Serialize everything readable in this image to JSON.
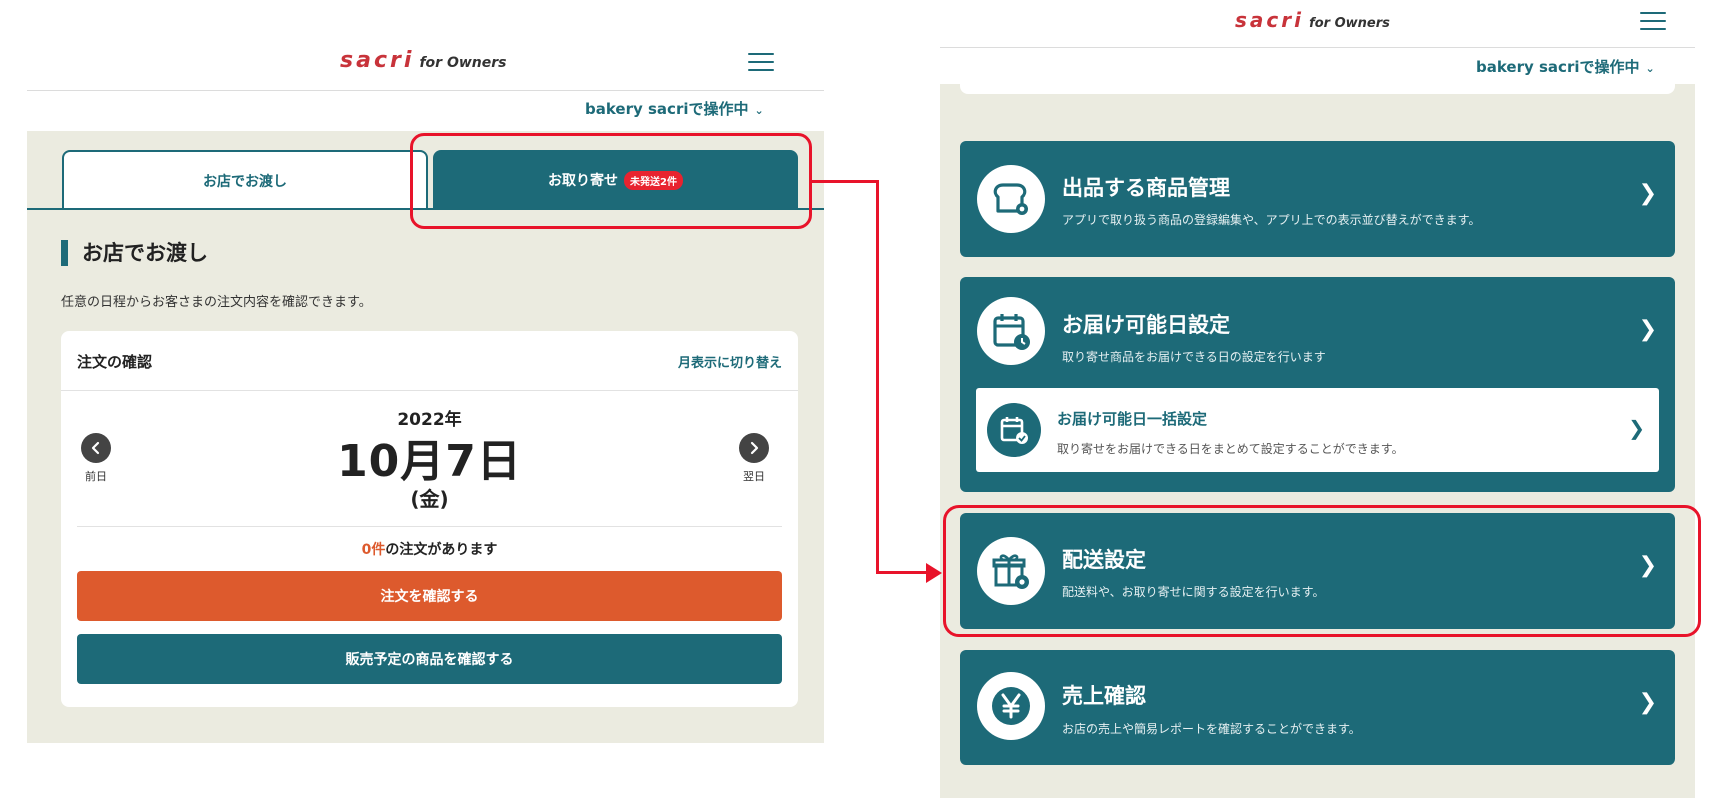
{
  "header": {
    "logo_mark": "sacri",
    "logo_sub": "for Owners",
    "operating_label": "bakery sacriで操作中"
  },
  "left": {
    "tabs": [
      {
        "label": "お店でお渡し"
      },
      {
        "label": "お取り寄せ",
        "badge": "未発送2件"
      }
    ],
    "section_title": "お店でお渡し",
    "section_desc": "任意の日程からお客さまの注文内容を確認できます。",
    "card": {
      "title": "注文の確認",
      "toggle": "月表示に切り替え",
      "year": "2022年",
      "date": "10月7日",
      "weekday": "(金)",
      "prev_label": "前日",
      "next_label": "翌日",
      "count_num": "0件",
      "count_text": "の注文があります",
      "btn_orders": "注文を確認する",
      "btn_products": "販売予定の商品を確認する"
    }
  },
  "right": {
    "menus": [
      {
        "title": "出品する商品管理",
        "desc": "アプリで取り扱う商品の登録編集や、アプリ上での表示並び替えができます。",
        "icon": "bread-gear-icon"
      },
      {
        "title": "お届け可能日設定",
        "desc": "取り寄せ商品をお届けできる日の設定を行います",
        "icon": "calendar-clock-icon",
        "sub": {
          "title": "お届け可能日一括設定",
          "desc": "取り寄せをお届けできる日をまとめて設定することができます。",
          "icon": "calendar-check-icon"
        }
      },
      {
        "title": "配送設定",
        "desc": "配送料や、お取り寄せに関する設定を行います。",
        "icon": "gift-gear-icon"
      },
      {
        "title": "売上確認",
        "desc": "お店の売上や簡易レポートを確認することができます。",
        "icon": "yen-icon"
      }
    ]
  },
  "colors": {
    "brand_teal": "#1d6a78",
    "accent_orange": "#dd5a2d",
    "logo_red": "#c8333a",
    "highlight_red": "#e8132a",
    "panel_bg": "#ebebe0"
  }
}
